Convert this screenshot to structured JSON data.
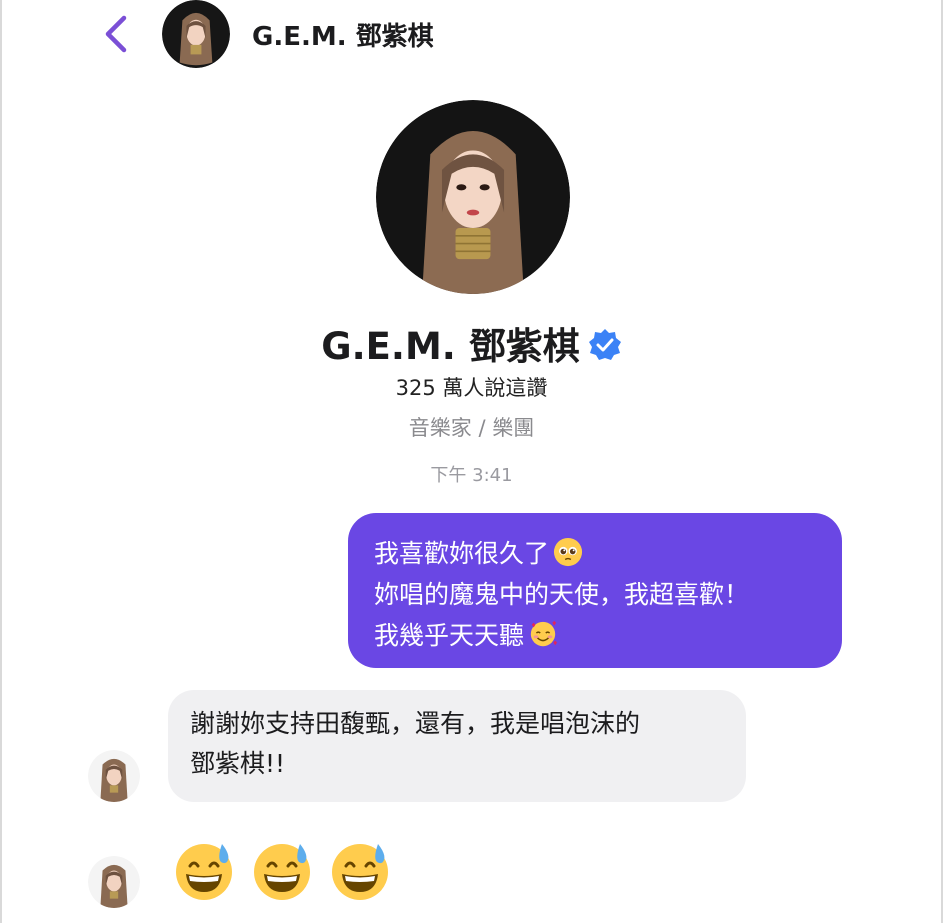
{
  "header": {
    "back_icon": "chevron-left-icon",
    "name": "G.E.M. 鄧紫棋"
  },
  "profile": {
    "name": "G.E.M. 鄧紫棋",
    "verified_icon": "verified-badge-icon",
    "likes": "325 萬人說這讚",
    "category": "音樂家 / 樂團"
  },
  "timestamp": "下午 3:41",
  "messages": {
    "outgoing": {
      "lines": [
        "我喜歡妳很久了",
        "妳唱的魔鬼中的天使，我超喜歡！",
        "我幾乎天天聽"
      ],
      "emojis": [
        "pleading-face-icon",
        "smiling-face-with-hearts-icon"
      ]
    },
    "incoming": {
      "lines": [
        "謝謝妳支持田馥甄，還有，我是唱泡沫的",
        "鄧紫棋!!"
      ]
    },
    "incoming_emoji": [
      "grinning-sweat-icon",
      "grinning-sweat-icon",
      "grinning-sweat-icon"
    ]
  },
  "colors": {
    "accent": "#7b4fd6",
    "outgoing_bubble": "#6a47e4",
    "incoming_bubble": "#f0f0f2",
    "verified": "#3b82f6"
  }
}
